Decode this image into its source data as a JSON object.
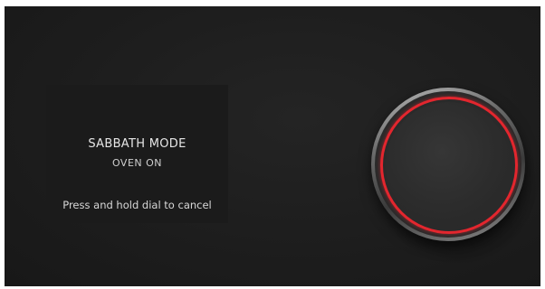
{
  "panel": {
    "title": "SABBATH MODE",
    "status": "OVEN ON",
    "instruction": "Press and hold dial to cancel"
  },
  "dial": {
    "icon": "control-dial",
    "ring_color": "#e3262e"
  }
}
